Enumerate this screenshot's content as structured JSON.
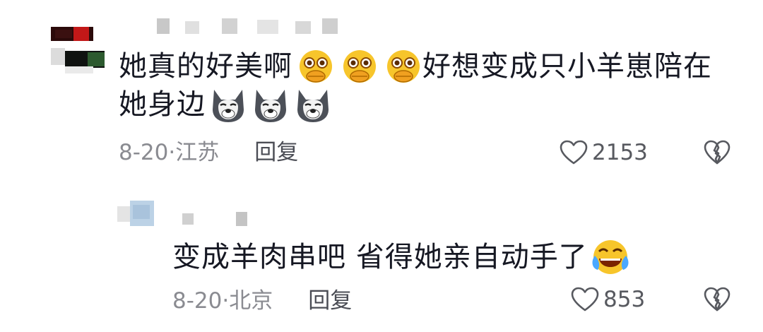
{
  "comments": [
    {
      "text_line1": "她真的好美啊",
      "text_line1_cont": "好想变成只小羊崽陪在",
      "text_line2": "她身边",
      "date": "8-20",
      "location": "江苏",
      "reply_label": "回复",
      "likes": "2153",
      "emoji_1": "flushed-hands-emoji",
      "emoji_2": "husky-dog-emoji"
    },
    {
      "text": "变成羊肉串吧 省得她亲自动手了",
      "date": "8-20",
      "location": "北京",
      "reply_label": "回复",
      "likes": "853",
      "emoji": "laughing-tears-emoji"
    }
  ],
  "separator": "·",
  "colors": {
    "text": "#161823",
    "meta": "#8a8b91",
    "emoji_yellow": "#f7c52b"
  }
}
